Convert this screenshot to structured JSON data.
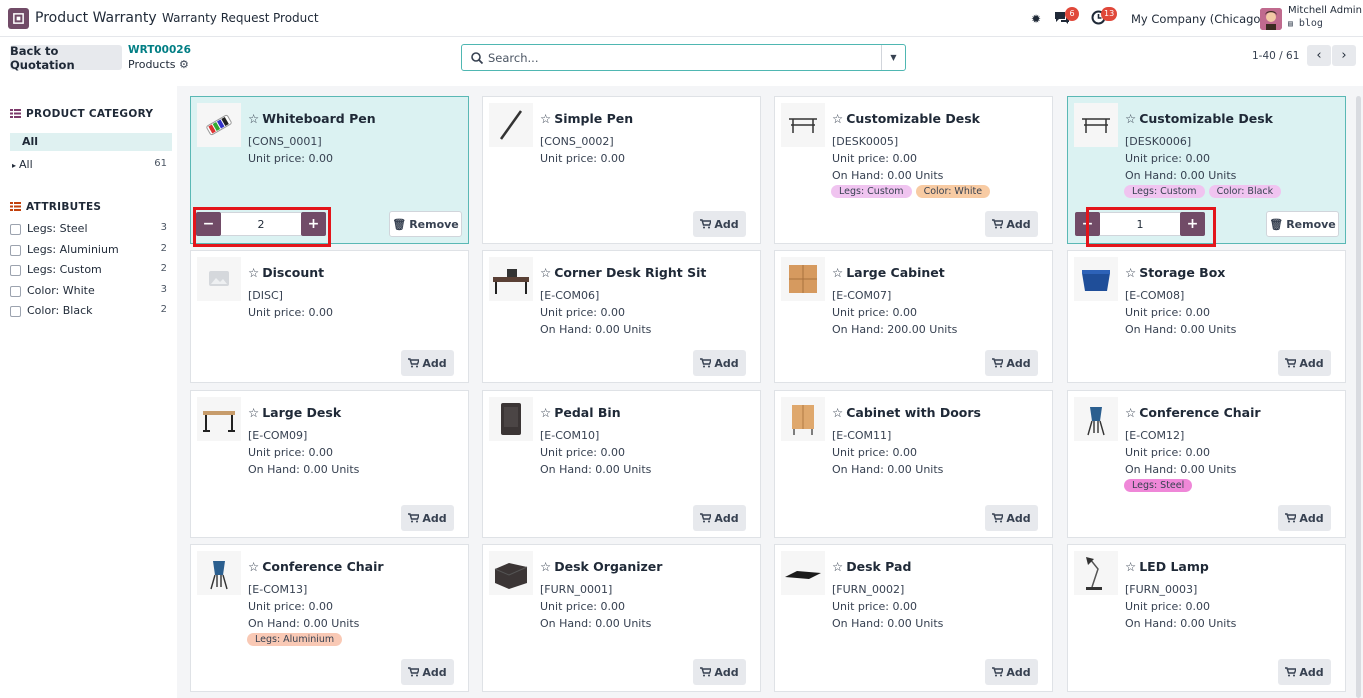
{
  "navbar": {
    "app_name": "Product Warranty",
    "menu": [
      "Warranty Request",
      "Product"
    ],
    "messages_badge": "6",
    "activity_badge": "13",
    "company": "My Company (Chicago)",
    "user_name": "Mitchell Admin",
    "user_db": "blog"
  },
  "control": {
    "back_label": "Back to Quotation",
    "breadcrumb_link": "WRT00026",
    "breadcrumb_current": "Products",
    "search_placeholder": "Search...",
    "pager": "1-40 / 61"
  },
  "sidebar": {
    "category_title": "PRODUCT CATEGORY",
    "category_active": "All",
    "categories": [
      {
        "label": "All",
        "count": "61"
      }
    ],
    "attributes_title": "ATTRIBUTES",
    "attributes": [
      {
        "label": "Legs: Steel",
        "count": "3"
      },
      {
        "label": "Legs: Aluminium",
        "count": "2"
      },
      {
        "label": "Legs: Custom",
        "count": "2"
      },
      {
        "label": "Color: White",
        "count": "3"
      },
      {
        "label": "Color: Black",
        "count": "2"
      }
    ]
  },
  "labels": {
    "add": "Add",
    "remove": "Remove",
    "star": "☆"
  },
  "colors": {
    "brand": "#714b67",
    "teal": "#017e84",
    "selected_card": "#dbf2f2",
    "highlight": "#e3151b",
    "tag_pink": "#f0b9ee",
    "tag_orange": "#f8cba3",
    "tag_hotpink": "#ef87d8",
    "tag_salmon": "#f9c9b5"
  },
  "products": [
    {
      "name": "Whiteboard Pen",
      "code": "[CONS_0001]",
      "price": "Unit price: 0.00",
      "on_hand": "",
      "tags": [],
      "selected": true,
      "qty": "2",
      "icon": "whiteboard-pen-image"
    },
    {
      "name": "Simple Pen",
      "code": "[CONS_0002]",
      "price": "Unit price: 0.00",
      "on_hand": "",
      "tags": [],
      "selected": false,
      "icon": "pen-image"
    },
    {
      "name": "Customizable Desk",
      "code": "[DESK0005]",
      "price": "Unit price: 0.00",
      "on_hand": "On Hand: 0.00 Units",
      "tags": [
        {
          "label": "Legs: Custom",
          "color": "#f0c4f0"
        },
        {
          "label": "Color: White",
          "color": "#f8cba3"
        }
      ],
      "selected": false,
      "icon": "desk-image"
    },
    {
      "name": "Customizable Desk",
      "code": "[DESK0006]",
      "price": "Unit price: 0.00",
      "on_hand": "On Hand: 0.00 Units",
      "tags": [
        {
          "label": "Legs: Custom",
          "color": "#f0c4f0"
        },
        {
          "label": "Color: Black",
          "color": "#f0c4f0"
        }
      ],
      "selected": true,
      "qty": "1",
      "icon": "desk-image"
    },
    {
      "name": "Discount",
      "code": "[DISC]",
      "price": "Unit price: 0.00",
      "on_hand": "",
      "tags": [],
      "selected": false,
      "icon": "placeholder-image"
    },
    {
      "name": "Corner Desk Right Sit",
      "code": "[E-COM06]",
      "price": "Unit price: 0.00",
      "on_hand": "On Hand: 0.00 Units",
      "tags": [],
      "selected": false,
      "icon": "corner-desk-image"
    },
    {
      "name": "Large Cabinet",
      "code": "[E-COM07]",
      "price": "Unit price: 0.00",
      "on_hand": "On Hand: 200.00 Units",
      "tags": [],
      "selected": false,
      "icon": "cabinet-image"
    },
    {
      "name": "Storage Box",
      "code": "[E-COM08]",
      "price": "Unit price: 0.00",
      "on_hand": "On Hand: 0.00 Units",
      "tags": [],
      "selected": false,
      "icon": "storage-box-image"
    },
    {
      "name": "Large Desk",
      "code": "[E-COM09]",
      "price": "Unit price: 0.00",
      "on_hand": "On Hand: 0.00 Units",
      "tags": [],
      "selected": false,
      "icon": "large-desk-image"
    },
    {
      "name": "Pedal Bin",
      "code": "[E-COM10]",
      "price": "Unit price: 0.00",
      "on_hand": "On Hand: 0.00 Units",
      "tags": [],
      "selected": false,
      "icon": "pedal-bin-image"
    },
    {
      "name": "Cabinet with Doors",
      "code": "[E-COM11]",
      "price": "Unit price: 0.00",
      "on_hand": "On Hand: 0.00 Units",
      "tags": [],
      "selected": false,
      "icon": "cabinet-doors-image"
    },
    {
      "name": "Conference Chair",
      "code": "[E-COM12]",
      "price": "Unit price: 0.00",
      "on_hand": "On Hand: 0.00 Units",
      "tags": [
        {
          "label": "Legs: Steel",
          "color": "#ef87d8"
        }
      ],
      "selected": false,
      "icon": "chair-image"
    },
    {
      "name": "Conference Chair",
      "code": "[E-COM13]",
      "price": "Unit price: 0.00",
      "on_hand": "On Hand: 0.00 Units",
      "tags": [
        {
          "label": "Legs: Aluminium",
          "color": "#f9c9b5"
        }
      ],
      "selected": false,
      "icon": "chair-image"
    },
    {
      "name": "Desk Organizer",
      "code": "[FURN_0001]",
      "price": "Unit price: 0.00",
      "on_hand": "On Hand: 0.00 Units",
      "tags": [],
      "selected": false,
      "icon": "organizer-image"
    },
    {
      "name": "Desk Pad",
      "code": "[FURN_0002]",
      "price": "Unit price: 0.00",
      "on_hand": "On Hand: 0.00 Units",
      "tags": [],
      "selected": false,
      "icon": "desk-pad-image"
    },
    {
      "name": "LED Lamp",
      "code": "[FURN_0003]",
      "price": "Unit price: 0.00",
      "on_hand": "On Hand: 0.00 Units",
      "tags": [],
      "selected": false,
      "icon": "lamp-image"
    }
  ]
}
